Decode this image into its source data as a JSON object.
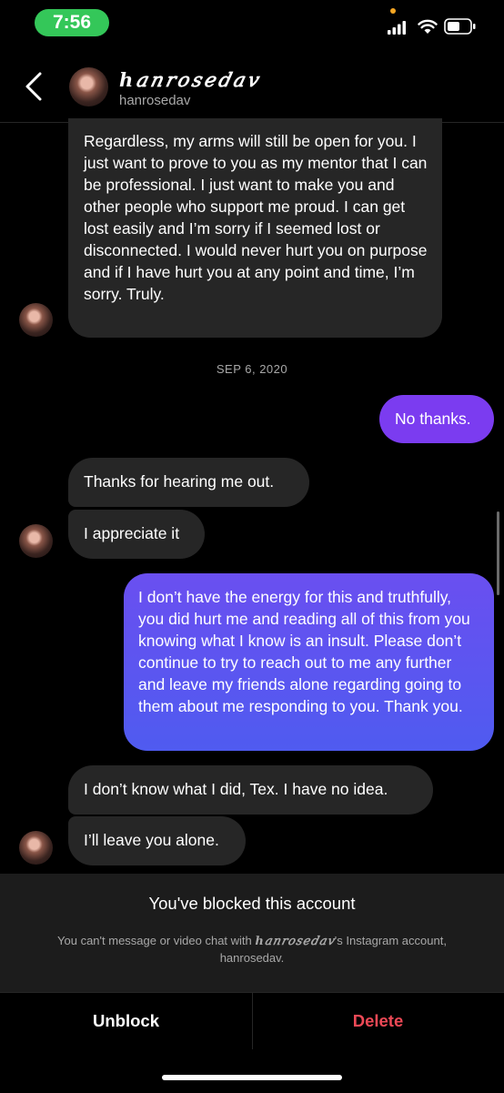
{
  "status_bar": {
    "time": "7:56"
  },
  "header": {
    "display_name": "ℎ𝑎𝑛𝑟𝑜𝑠𝑒𝑑𝑎𝑣",
    "username": "hanrosedav"
  },
  "messages": [
    {
      "from": "them",
      "text": "Regardless, my arms will still be open for you. I just want to prove to you as my mentor that I can be professional. I just want to make you and other people who support me proud. I can get lost easily and I’m sorry if I seemed lost or disconnected. I would never hurt you on purpose and if I have hurt you at any point and time, I’m sorry. Truly."
    },
    {
      "from": "me",
      "text": "No thanks."
    },
    {
      "from": "them",
      "text": "Thanks for hearing me out."
    },
    {
      "from": "them",
      "text": "I appreciate it"
    },
    {
      "from": "me",
      "text": "I don’t have the energy for this and truthfully, you did hurt me and reading all of this from you knowing what I know is an insult. Please don’t continue to try to reach out to me any further and leave my friends alone regarding going to them about me responding to you. Thank you."
    },
    {
      "from": "them",
      "text": "I don’t know what I did, Tex. I have no idea."
    },
    {
      "from": "them",
      "text": "I’ll leave you alone."
    }
  ],
  "date_separator": "SEP 6, 2020",
  "blocked": {
    "title": "You've blocked this account",
    "desc_prefix": "You can't message or video chat with ",
    "desc_name": "ℎ𝑎𝑛𝑟𝑜𝑠𝑒𝑑𝑎𝑣",
    "desc_suffix": "'s Instagram account,",
    "desc_line2": "hanrosedav."
  },
  "actions": {
    "unblock": "Unblock",
    "delete": "Delete"
  },
  "colors": {
    "sent_bubble": "#7b3cf0",
    "sent_gradient_end": "#4f5bf0",
    "received_bubble": "#262626",
    "delete": "#ed4956",
    "time_pill": "#34c759"
  }
}
